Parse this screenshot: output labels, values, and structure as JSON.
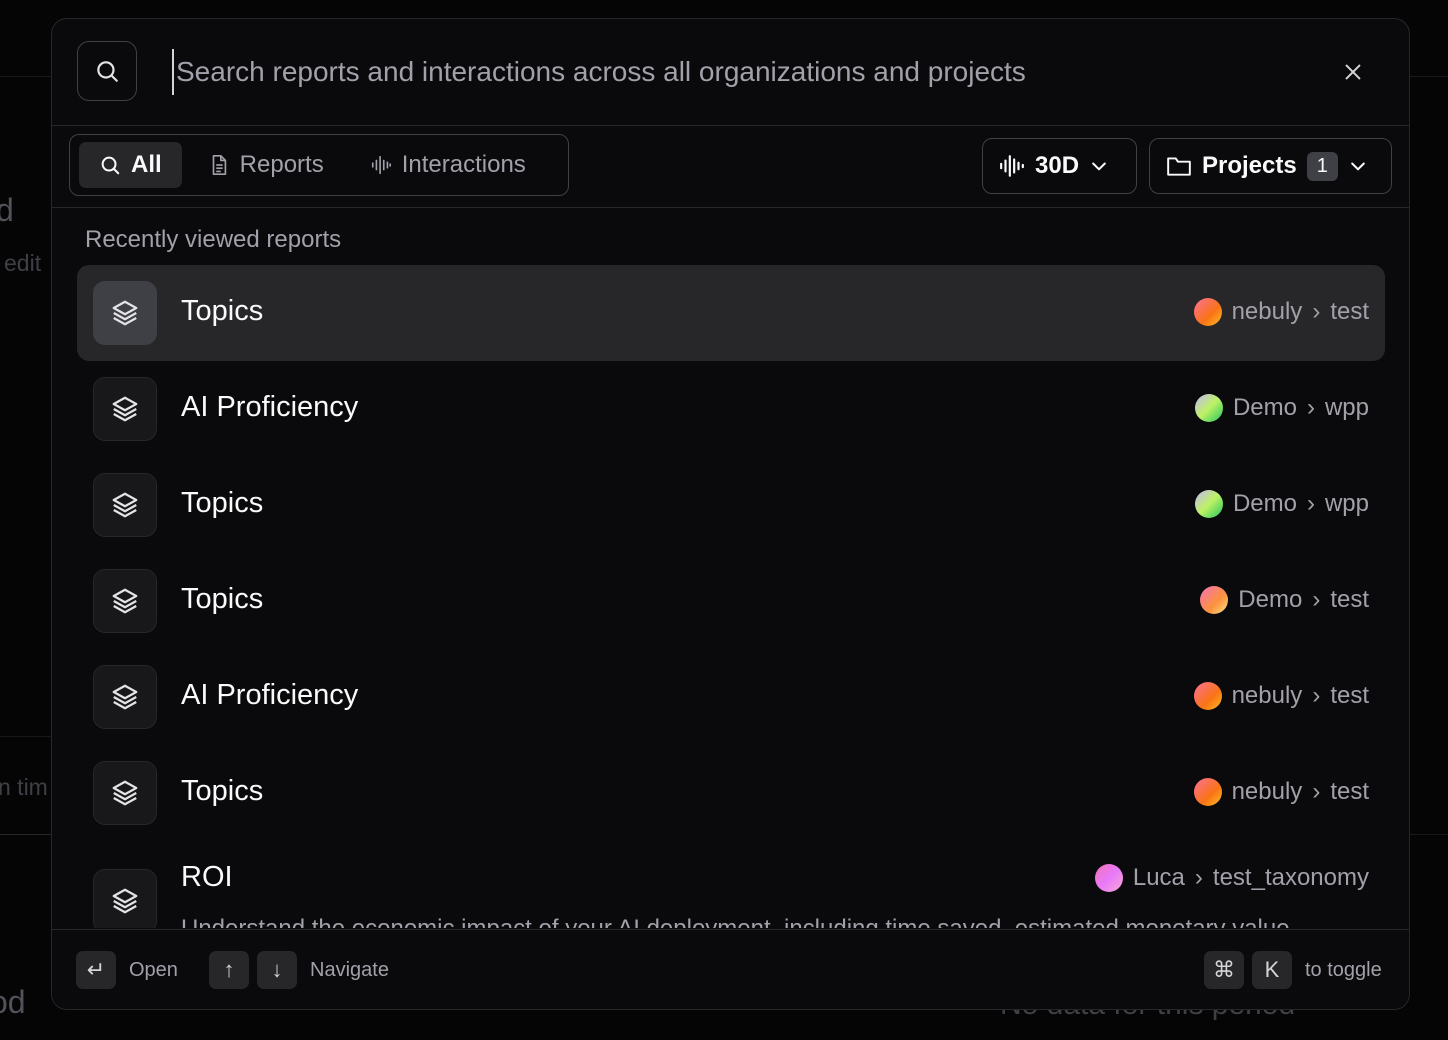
{
  "background": {
    "text_d": "d",
    "text_edit": "edit",
    "text_time": "n tim",
    "text_od": "od",
    "text_nodata": "No data for this period"
  },
  "search": {
    "placeholder": "Search reports and interactions across all organizations and projects",
    "value": ""
  },
  "tabs": [
    {
      "label": "All",
      "icon": "search-icon",
      "active": true
    },
    {
      "label": "Reports",
      "icon": "document-icon",
      "active": false
    },
    {
      "label": "Interactions",
      "icon": "waveform-icon",
      "active": false
    }
  ],
  "filters": {
    "period": {
      "label": "30D",
      "icon": "waveform-icon"
    },
    "projects": {
      "label": "Projects",
      "count": "1",
      "icon": "folder-icon"
    }
  },
  "section_title": "Recently viewed reports",
  "items": [
    {
      "title": "Topics",
      "org": "nebuly",
      "project": "test",
      "selected": true
    },
    {
      "title": "AI Proficiency",
      "org": "Demo",
      "project": "wpp"
    },
    {
      "title": "Topics",
      "org": "Demo",
      "project": "wpp"
    },
    {
      "title": "Topics",
      "org": "Demo",
      "project": "test"
    },
    {
      "title": "AI Proficiency",
      "org": "nebuly",
      "project": "test"
    },
    {
      "title": "Topics",
      "org": "nebuly",
      "project": "test"
    },
    {
      "title": "ROI",
      "org": "Luca",
      "project": "test_taxonomy",
      "description": "Understand the economic impact of your AI deployment, including time saved, estimated monetary value"
    }
  ],
  "separator": "›",
  "footer": {
    "open_key": "↵",
    "open_label": "Open",
    "up_key": "↑",
    "down_key": "↓",
    "navigate_label": "Navigate",
    "cmd_key": "⌘",
    "k_key": "K",
    "toggle_label": "to toggle"
  }
}
